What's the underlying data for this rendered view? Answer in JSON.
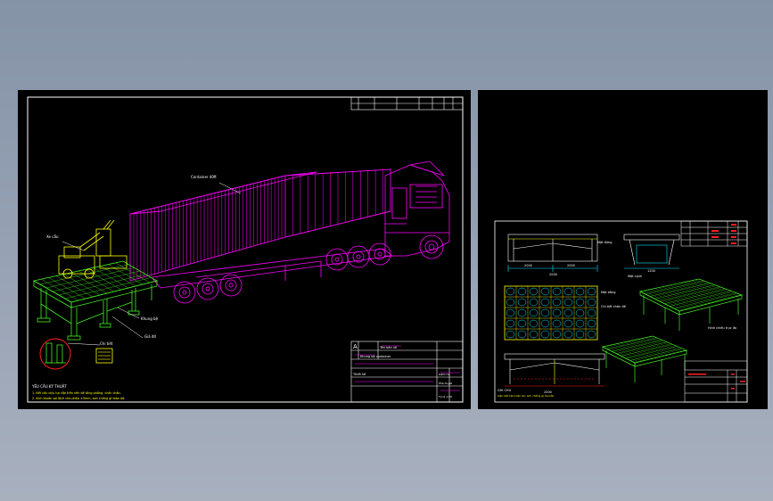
{
  "main_sheet": {
    "callouts": {
      "container": "Container 40ft",
      "crane": "Xe cẩu",
      "stand": "Khung bệ",
      "rack": "Giá đỡ",
      "detail": "Chi tiết"
    },
    "title_block": {
      "rev": "A",
      "rows": [
        "Tên bản vẽ",
        "Khung bệ container",
        "Thiết kế",
        "Kiểm tra",
        "Phê duyệt",
        "Tỷ lệ 1:50"
      ]
    },
    "notes": {
      "heading": "YÊU CẦU KỸ THUẬT",
      "line1": "1. Kết cấu chịu lực đặt trên nền bê tông phẳng, chắc chắn.",
      "line2": "2. Kích thước sai lệch cho phép ±5mm, sơn chống gỉ toàn bộ."
    }
  },
  "side_sheet": {
    "dims": {
      "d1": "2000",
      "d2": "2000",
      "d3": "2000",
      "d4": "1200",
      "d5": "2000"
    },
    "labels": {
      "front": "Mặt đứng",
      "side": "Mặt cạnh",
      "plan": "Mặt bằng",
      "iso": "Hình chiếu trục đo",
      "detail": "Chi tiết chân đế"
    },
    "notes": {
      "heading": "GHI CHÚ",
      "line": "Liên kết hàn toàn bộ, sơn chống gỉ hai lớp."
    }
  },
  "colors": {
    "sheet": "#000000",
    "magenta": "#ff00ff",
    "green": "#44ee22",
    "yellow": "#ffff00",
    "white": "#ffffff",
    "cyan": "#00e5ff",
    "red": "#ff2020"
  }
}
